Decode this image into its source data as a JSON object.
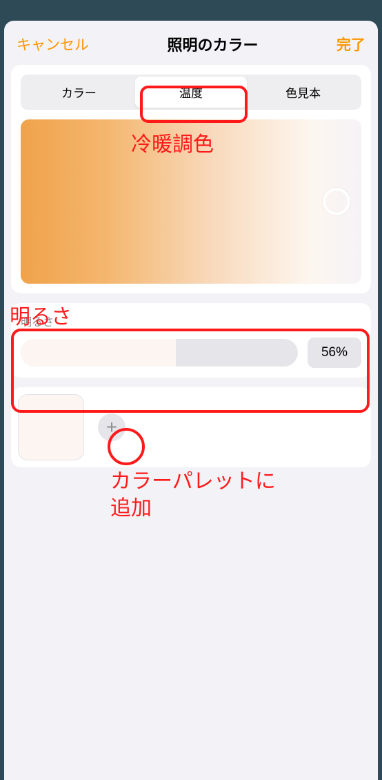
{
  "header": {
    "cancel": "キャンセル",
    "title": "照明のカラー",
    "done": "完了"
  },
  "tabs": {
    "color": "カラー",
    "temperature": "温度",
    "swatches": "色見本",
    "active_index": 1
  },
  "brightness": {
    "label": "明るさ",
    "value_percent": 56,
    "value_display": "56%"
  },
  "palette": {
    "swatch_color": "#fcf5f1"
  },
  "annotations": {
    "temp_label": "冷暖調色",
    "brightness_label": "明るさ",
    "add_label": "カラーパレットに\n追加"
  }
}
